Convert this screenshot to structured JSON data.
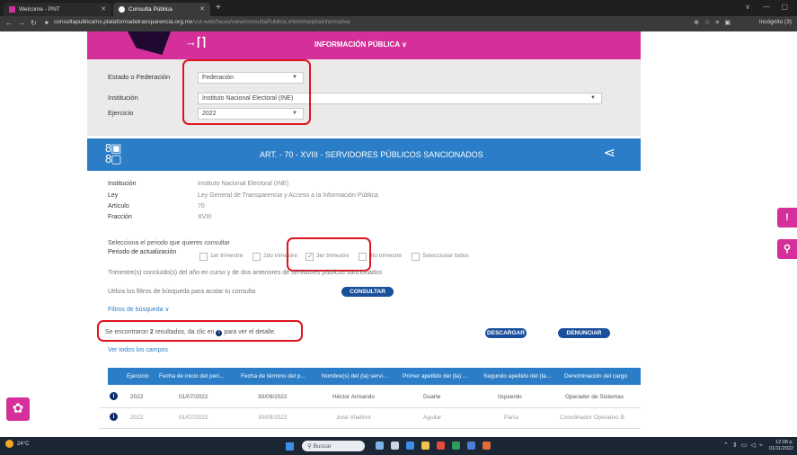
{
  "browser": {
    "tabs": [
      {
        "title": "Welcome - PNT"
      },
      {
        "title": "Consulta Pública"
      }
    ],
    "new_tab": "+",
    "url_host": "consultapublicamx.plataformadetransparencia.org.mx",
    "url_path": "/vut-web/faces/view/consultaPublica.xhtml#tarjetaInformativa",
    "profile": "Incógnito (3)",
    "colors": {
      "chrome": "#1f1f1f"
    }
  },
  "header": {
    "title": "INFORMACIÓN PÚBLICA",
    "chevron": "∨",
    "accent": "#d52f99"
  },
  "form": {
    "estado_label": "Estado o Federación",
    "estado_value": "Federación",
    "institucion_label": "Institución",
    "institucion_value": "Instituto Nacional Electoral (INE)",
    "ejercicio_label": "Ejercicio",
    "ejercicio_value": "2022"
  },
  "section": {
    "title": "ART. - 70 - XVIII - SERVIDORES PÚBLICOS SANCIONADOS",
    "color": "#2a7dc6",
    "icon": "grid-people-icon",
    "share_icon": "share-icon"
  },
  "details": [
    {
      "label": "Institución",
      "value": "Instituto Nacional Electoral (INE)"
    },
    {
      "label": "Ley",
      "value": "Ley General de Transparencia y Acceso a la Información Pública"
    },
    {
      "label": "Artículo",
      "value": "70"
    },
    {
      "label": "Fracción",
      "value": "XVIII"
    }
  ],
  "periodo": {
    "prompt": "Selecciona el periodo que quieres consultar",
    "label": "Periodo de actualización",
    "options": [
      {
        "label": "1er trimestre",
        "checked": false
      },
      {
        "label": "2do trimestre",
        "checked": false
      },
      {
        "label": "3er trimestre",
        "checked": true
      },
      {
        "label": "4to trimestre",
        "checked": false
      },
      {
        "label": "Seleccionar todos",
        "checked": false
      }
    ],
    "note": "Trimestre(s) concluido(s) del año en curso y de dos anteriores de servidores públicos sancionados"
  },
  "filtros": {
    "hint": "Utiliza los filtros de búsqueda para acotar tu consulta",
    "consultar": "CONSULTAR",
    "toggle": "Filtros de búsqueda ∨"
  },
  "results": {
    "prefix": "Se encontraron ",
    "count": "2",
    "suffix_a": " resultados, da clic en ",
    "suffix_b": " para ver el detalle.",
    "descargar": "DESCARGAR",
    "denunciar": "DENUNCIAR",
    "ver_todos": "Ver todos los campos"
  },
  "table": {
    "headers": [
      "Ejercicio",
      "Fecha de inicio del peri...",
      "Fecha de término del p...",
      "Nombre(s) del (la) servi...",
      "Primer apellido del (la) ...",
      "Segundo apellido del (la...",
      "Denominación del cargo"
    ],
    "rows": [
      [
        "2022",
        "01/07/2022",
        "30/09/2022",
        "Héctor Armando",
        "Duarte",
        "Izquierdo",
        "Operador de Sistemas"
      ],
      [
        "2022",
        "01/07/2022",
        "30/09/2022",
        "José Vladimir",
        "Aguilar",
        "Parra",
        "Coordinador Operativo B"
      ]
    ]
  },
  "taskbar": {
    "temp": "24°C",
    "search": "Buscar",
    "time": "12:08 p.",
    "date": "01/11/2022"
  }
}
